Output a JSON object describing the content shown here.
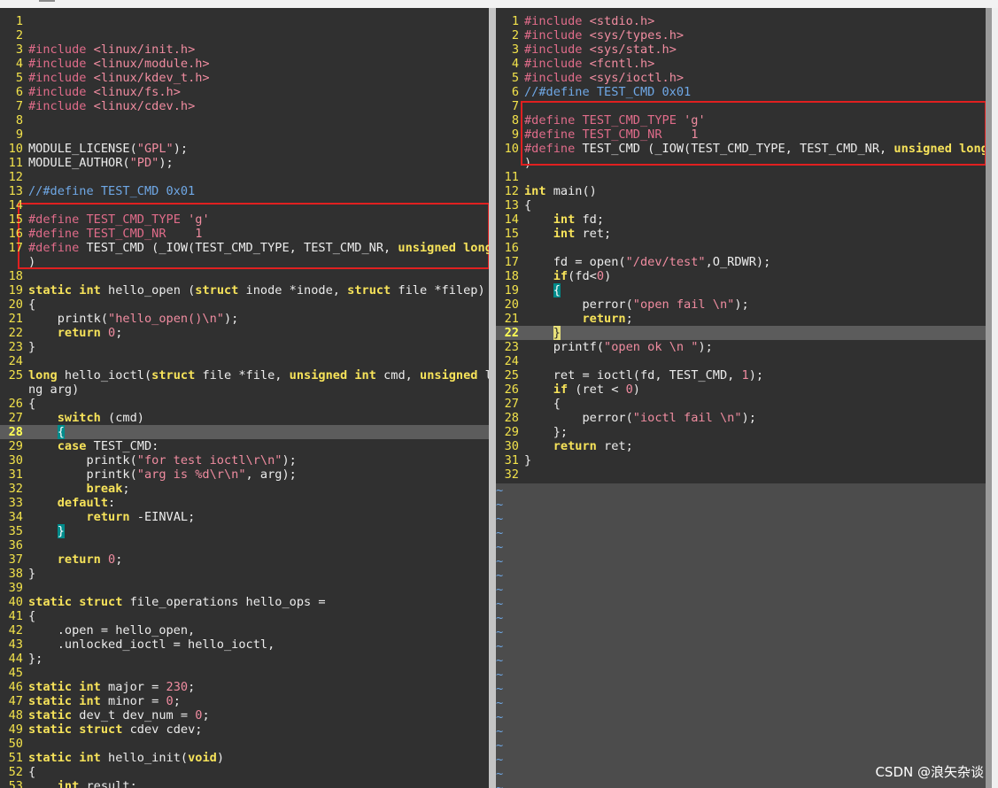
{
  "colors": {
    "background": "#303030",
    "line_number": "#f2e24b",
    "preprocessor": "#e06c8a",
    "string": "#f08ca0",
    "keyword": "#f7e35a",
    "comment": "#6fa8e6",
    "current_line": "#5c5c5c",
    "highlight_box": "#e02020"
  },
  "left_pane": {
    "current_line": 28,
    "lines": [
      {
        "n": "1",
        "t": ""
      },
      {
        "n": "2",
        "t": ""
      },
      {
        "n": "3",
        "t": "#include <linux/init.h>"
      },
      {
        "n": "4",
        "t": "#include <linux/module.h>"
      },
      {
        "n": "5",
        "t": "#include <linux/kdev_t.h>"
      },
      {
        "n": "6",
        "t": "#include <linux/fs.h>"
      },
      {
        "n": "7",
        "t": "#include <linux/cdev.h>"
      },
      {
        "n": "8",
        "t": ""
      },
      {
        "n": "9",
        "t": ""
      },
      {
        "n": "10",
        "t": "MODULE_LICENSE(\"GPL\");"
      },
      {
        "n": "11",
        "t": "MODULE_AUTHOR(\"PD\");"
      },
      {
        "n": "12",
        "t": ""
      },
      {
        "n": "13",
        "t": "//#define TEST_CMD 0x01"
      },
      {
        "n": "14",
        "t": ""
      },
      {
        "n": "15",
        "t": "#define TEST_CMD_TYPE 'g'"
      },
      {
        "n": "16",
        "t": "#define TEST_CMD_NR    1"
      },
      {
        "n": "17",
        "t": "#define TEST_CMD (_IOW(TEST_CMD_TYPE, TEST_CMD_NR, unsigned long)"
      },
      {
        "n": "",
        "t": ")"
      },
      {
        "n": "18",
        "t": ""
      },
      {
        "n": "19",
        "t": "static int hello_open (struct inode *inode, struct file *filep)"
      },
      {
        "n": "20",
        "t": "{"
      },
      {
        "n": "21",
        "t": "    printk(\"hello_open()\\n\");"
      },
      {
        "n": "22",
        "t": "    return 0;"
      },
      {
        "n": "23",
        "t": "}"
      },
      {
        "n": "24",
        "t": ""
      },
      {
        "n": "25",
        "t": "long hello_ioctl(struct file *file, unsigned int cmd, unsigned lo"
      },
      {
        "n": "",
        "t": "ng arg)"
      },
      {
        "n": "26",
        "t": "{"
      },
      {
        "n": "27",
        "t": "    switch (cmd)"
      },
      {
        "n": "28",
        "t": "    {"
      },
      {
        "n": "29",
        "t": "    case TEST_CMD:"
      },
      {
        "n": "30",
        "t": "        printk(\"for test ioctl\\r\\n\");"
      },
      {
        "n": "31",
        "t": "        printk(\"arg is %d\\r\\n\", arg);"
      },
      {
        "n": "32",
        "t": "        break;"
      },
      {
        "n": "33",
        "t": "    default:"
      },
      {
        "n": "34",
        "t": "        return -EINVAL;"
      },
      {
        "n": "35",
        "t": "    }"
      },
      {
        "n": "36",
        "t": ""
      },
      {
        "n": "37",
        "t": "    return 0;"
      },
      {
        "n": "38",
        "t": "}"
      },
      {
        "n": "39",
        "t": ""
      },
      {
        "n": "40",
        "t": "static struct file_operations hello_ops ="
      },
      {
        "n": "41",
        "t": "{"
      },
      {
        "n": "42",
        "t": "    .open = hello_open,"
      },
      {
        "n": "43",
        "t": "    .unlocked_ioctl = hello_ioctl,"
      },
      {
        "n": "44",
        "t": "};"
      },
      {
        "n": "45",
        "t": ""
      },
      {
        "n": "46",
        "t": "static int major = 230;"
      },
      {
        "n": "47",
        "t": "static int minor = 0;"
      },
      {
        "n": "48",
        "t": "static dev_t dev_num = 0;"
      },
      {
        "n": "49",
        "t": "static struct cdev cdev;"
      },
      {
        "n": "50",
        "t": ""
      },
      {
        "n": "51",
        "t": "static int hello_init(void)"
      },
      {
        "n": "52",
        "t": "{"
      },
      {
        "n": "53",
        "t": "    int result;"
      }
    ]
  },
  "right_pane": {
    "current_line": 22,
    "tilde": "~",
    "lines": [
      {
        "n": "1",
        "t": "#include <stdio.h>"
      },
      {
        "n": "2",
        "t": "#include <sys/types.h>"
      },
      {
        "n": "3",
        "t": "#include <sys/stat.h>"
      },
      {
        "n": "4",
        "t": "#include <fcntl.h>"
      },
      {
        "n": "5",
        "t": "#include <sys/ioctl.h>"
      },
      {
        "n": "6",
        "t": "//#define TEST_CMD 0x01"
      },
      {
        "n": "7",
        "t": ""
      },
      {
        "n": "8",
        "t": "#define TEST_CMD_TYPE 'g'"
      },
      {
        "n": "9",
        "t": "#define TEST_CMD_NR    1"
      },
      {
        "n": "10",
        "t": "#define TEST_CMD (_IOW(TEST_CMD_TYPE, TEST_CMD_NR, unsigned long)"
      },
      {
        "n": "",
        "t": ")"
      },
      {
        "n": "11",
        "t": ""
      },
      {
        "n": "12",
        "t": "int main()"
      },
      {
        "n": "13",
        "t": "{"
      },
      {
        "n": "14",
        "t": "    int fd;"
      },
      {
        "n": "15",
        "t": "    int ret;"
      },
      {
        "n": "16",
        "t": ""
      },
      {
        "n": "17",
        "t": "    fd = open(\"/dev/test\",O_RDWR);"
      },
      {
        "n": "18",
        "t": "    if(fd<0)"
      },
      {
        "n": "19",
        "t": "    {"
      },
      {
        "n": "20",
        "t": "        perror(\"open fail \\n\");"
      },
      {
        "n": "21",
        "t": "        return;"
      },
      {
        "n": "22",
        "t": "    }"
      },
      {
        "n": "23",
        "t": "    printf(\"open ok \\n \");"
      },
      {
        "n": "24",
        "t": ""
      },
      {
        "n": "25",
        "t": "    ret = ioctl(fd, TEST_CMD, 1);"
      },
      {
        "n": "26",
        "t": "    if (ret < 0)"
      },
      {
        "n": "27",
        "t": "    {"
      },
      {
        "n": "28",
        "t": "        perror(\"ioctl fail \\n\");"
      },
      {
        "n": "29",
        "t": "    };"
      },
      {
        "n": "30",
        "t": "    return ret;"
      },
      {
        "n": "31",
        "t": "}"
      },
      {
        "n": "32",
        "t": ""
      }
    ]
  },
  "watermark": "CSDN @浪矢杂谈"
}
